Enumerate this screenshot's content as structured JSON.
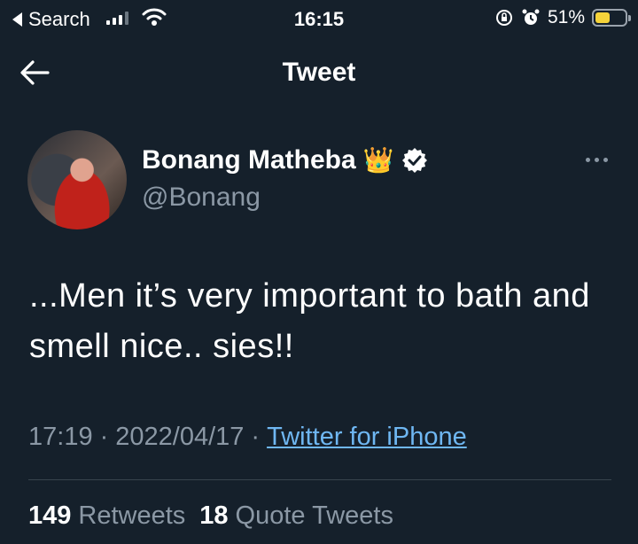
{
  "status_bar": {
    "back_label": "Search",
    "time": "16:15",
    "battery_percent": "51%",
    "battery_level": 0.51,
    "icons": [
      "signal-icon",
      "wifi-icon",
      "rotation-lock-icon",
      "alarm-icon",
      "battery-icon"
    ]
  },
  "nav": {
    "title": "Tweet",
    "back_icon": "arrow-left-icon"
  },
  "author": {
    "name": "Bonang Matheba",
    "emoji": "👑",
    "handle": "@Bonang",
    "verified": true
  },
  "tweet": {
    "text": "...Men it’s very important to bath and smell nice.. sies!!",
    "time": "17:19",
    "date": "2022/04/17",
    "separator": "·",
    "source": "Twitter for iPhone"
  },
  "stats": {
    "retweets_count": "149",
    "retweets_label": "Retweets",
    "quotes_count": "18",
    "quotes_label": "Quote Tweets"
  },
  "colors": {
    "background": "#15202b",
    "muted_text": "#8b98a5",
    "link": "#6fb7f2",
    "battery_fill": "#f5d33a"
  }
}
